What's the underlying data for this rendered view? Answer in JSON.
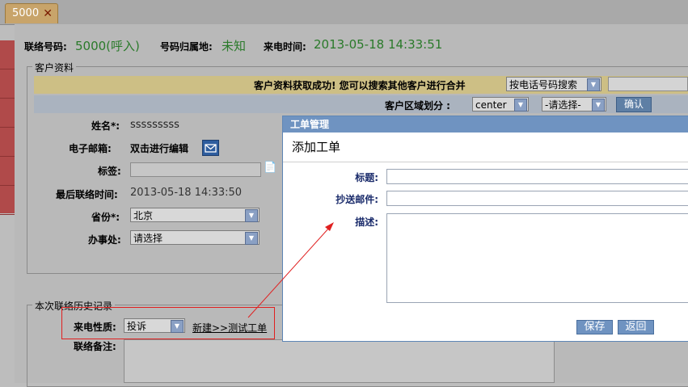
{
  "tab": {
    "label": "5000",
    "close": "✕"
  },
  "header": {
    "contact_no_label": "联络号码:",
    "contact_no_value": "5000(呼入)",
    "origin_label": "号码归属地:",
    "origin_value": "未知",
    "call_time_label": "来电时间:",
    "call_time_value": "2013-05-18 14:33:51"
  },
  "customer": {
    "legend": "客户资料",
    "success_msg": "客户资料获取成功! 您可以搜索其他客户进行合并",
    "search_mode": "按电话号码搜索",
    "region_label": "客户区域划分 :",
    "region_value": "center",
    "region_sub": "-请选择-",
    "confirm": "确认",
    "name_label": "姓名*:",
    "name_value": "sssssssss",
    "email_label": "电子邮箱:",
    "email_value": "双击进行编辑",
    "tag_label": "标签:",
    "last_contact_label": "最后联络时间:",
    "last_contact_value": "2013-05-18 14:33:50",
    "province_label": "省份*:",
    "province_value": "北京",
    "office_label": "办事处:",
    "office_value": "请选择"
  },
  "history": {
    "legend": "本次联络历史记录",
    "nature_label": "来电性质:",
    "nature_value": "投诉",
    "new_link": "新建>>测试工单",
    "remark_label": "联络备注:"
  },
  "dialog": {
    "title": "工单管理",
    "subtitle": "添加工单",
    "field_title": "标题:",
    "field_cc": "抄送邮件:",
    "field_desc": "描述:",
    "save": "保存",
    "back": "返回"
  },
  "colors": {
    "accent_red": "#e02020",
    "dialog_blue": "#6f93c1",
    "value_green": "#2a7a2a"
  }
}
